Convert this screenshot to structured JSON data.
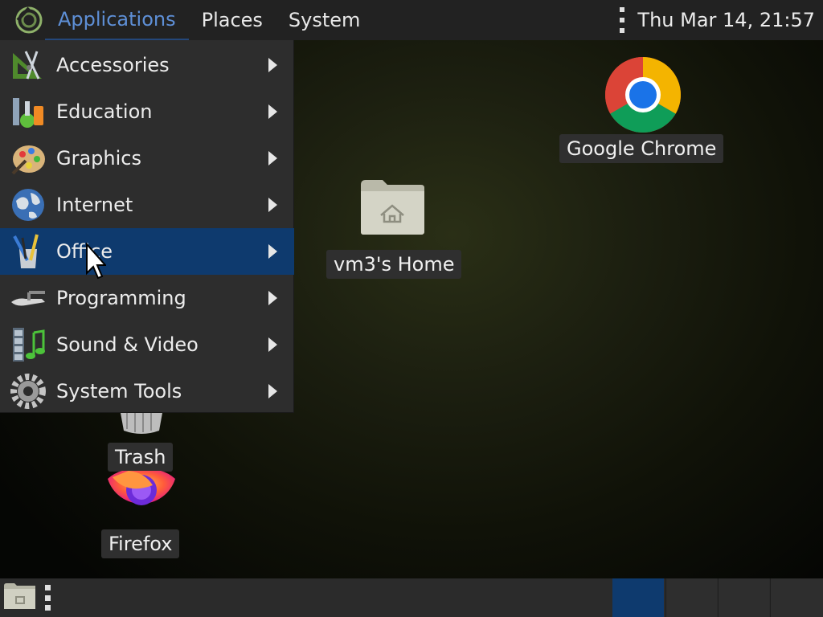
{
  "top_panel": {
    "menus": [
      "Applications",
      "Places",
      "System"
    ],
    "clock": "Thu Mar 14, 21:57"
  },
  "app_menu": {
    "items": [
      {
        "label": "Accessories",
        "icon": "accessories-icon"
      },
      {
        "label": "Education",
        "icon": "education-icon"
      },
      {
        "label": "Graphics",
        "icon": "graphics-icon"
      },
      {
        "label": "Internet",
        "icon": "internet-icon"
      },
      {
        "label": "Office",
        "icon": "office-icon",
        "highlighted": true
      },
      {
        "label": "Programming",
        "icon": "programming-icon"
      },
      {
        "label": "Sound & Video",
        "icon": "sound-video-icon"
      },
      {
        "label": "System Tools",
        "icon": "system-tools-icon"
      }
    ]
  },
  "desktop": {
    "chrome_label": "Google Chrome",
    "home_label": "vm3's Home",
    "trash_label": "Trash",
    "firefox_label": "Firefox"
  },
  "colors": {
    "panel": "#222222",
    "menu_bg": "#2d2d2d",
    "highlight": "#0e3a6e",
    "active_menu_text": "#5e8fd6"
  }
}
